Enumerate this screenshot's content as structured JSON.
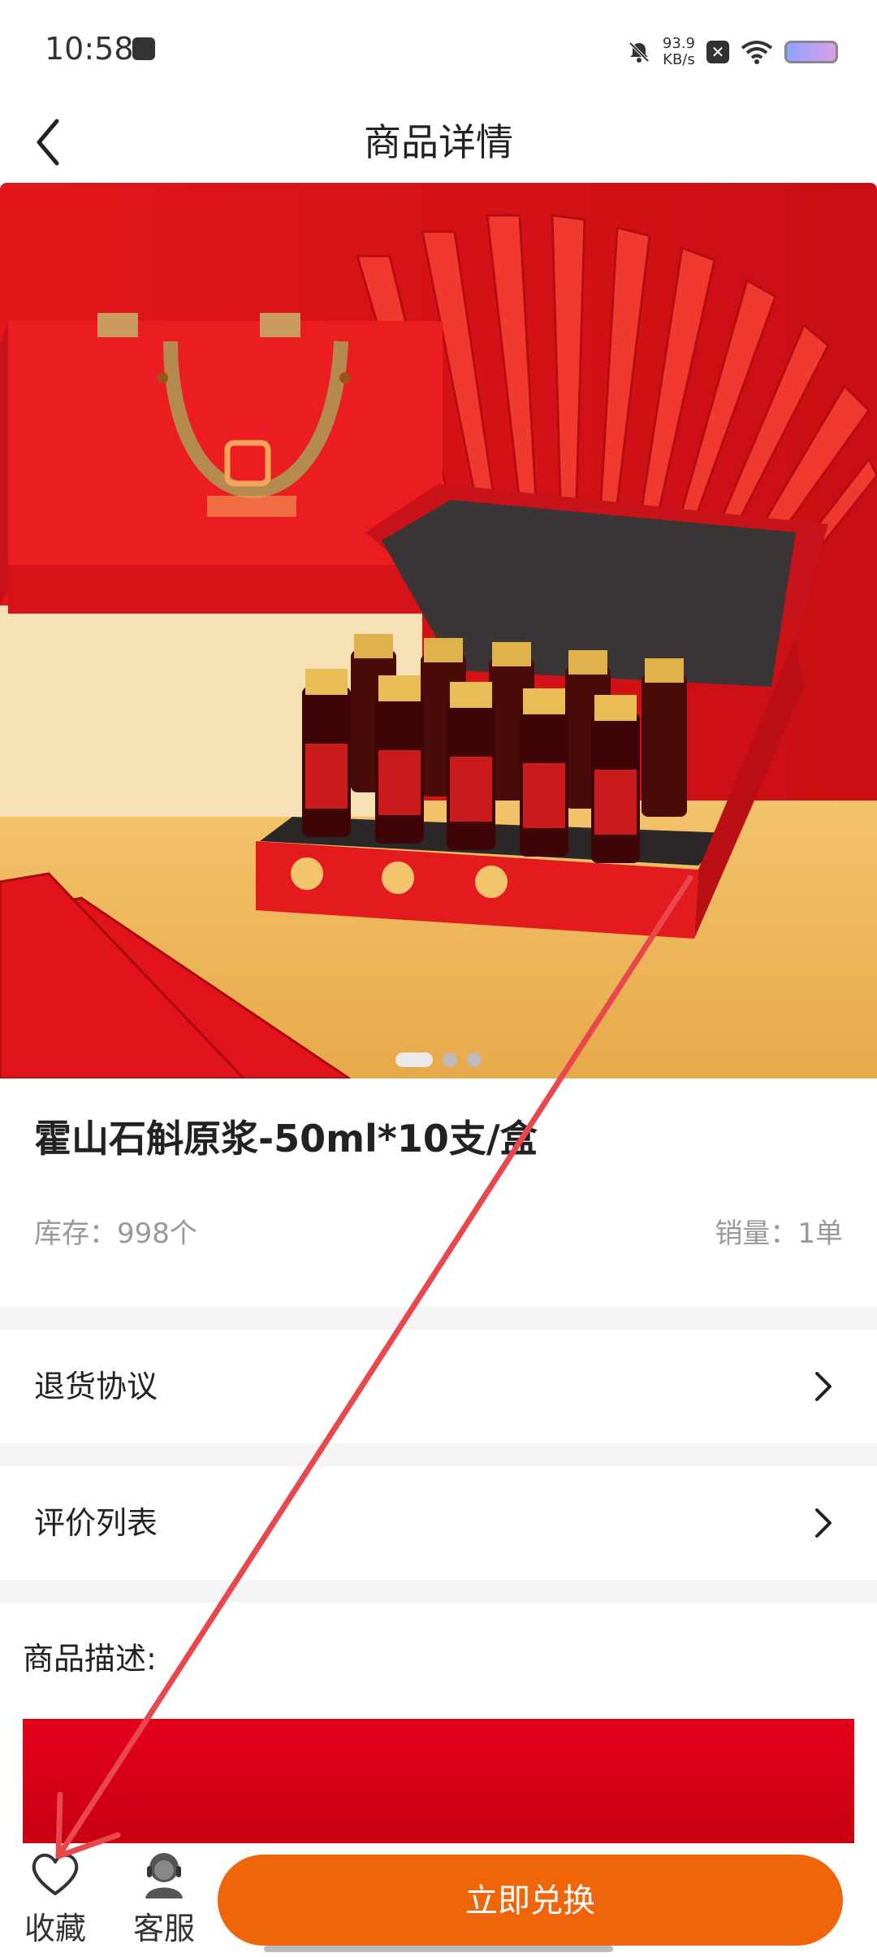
{
  "status_bar": {
    "time": "10:58",
    "net_speed": "93.9",
    "net_unit": "KB/s"
  },
  "header": {
    "title": "商品详情"
  },
  "carousel": {
    "page_count": 3,
    "active_index": 0
  },
  "product": {
    "name": "霍山石斛原浆-50ml*10支/盒",
    "stock": "库存：998个",
    "sales": "销量：1单"
  },
  "rows": [
    {
      "label": "退货协议"
    },
    {
      "label": "评价列表"
    }
  ],
  "description": {
    "label": "商品描述:"
  },
  "bottom_bar": {
    "favorite_label": "收藏",
    "service_label": "客服",
    "redeem_label": "立即兑换"
  },
  "colors": {
    "accent": "#f0640a",
    "product_red": "#e3001b"
  }
}
